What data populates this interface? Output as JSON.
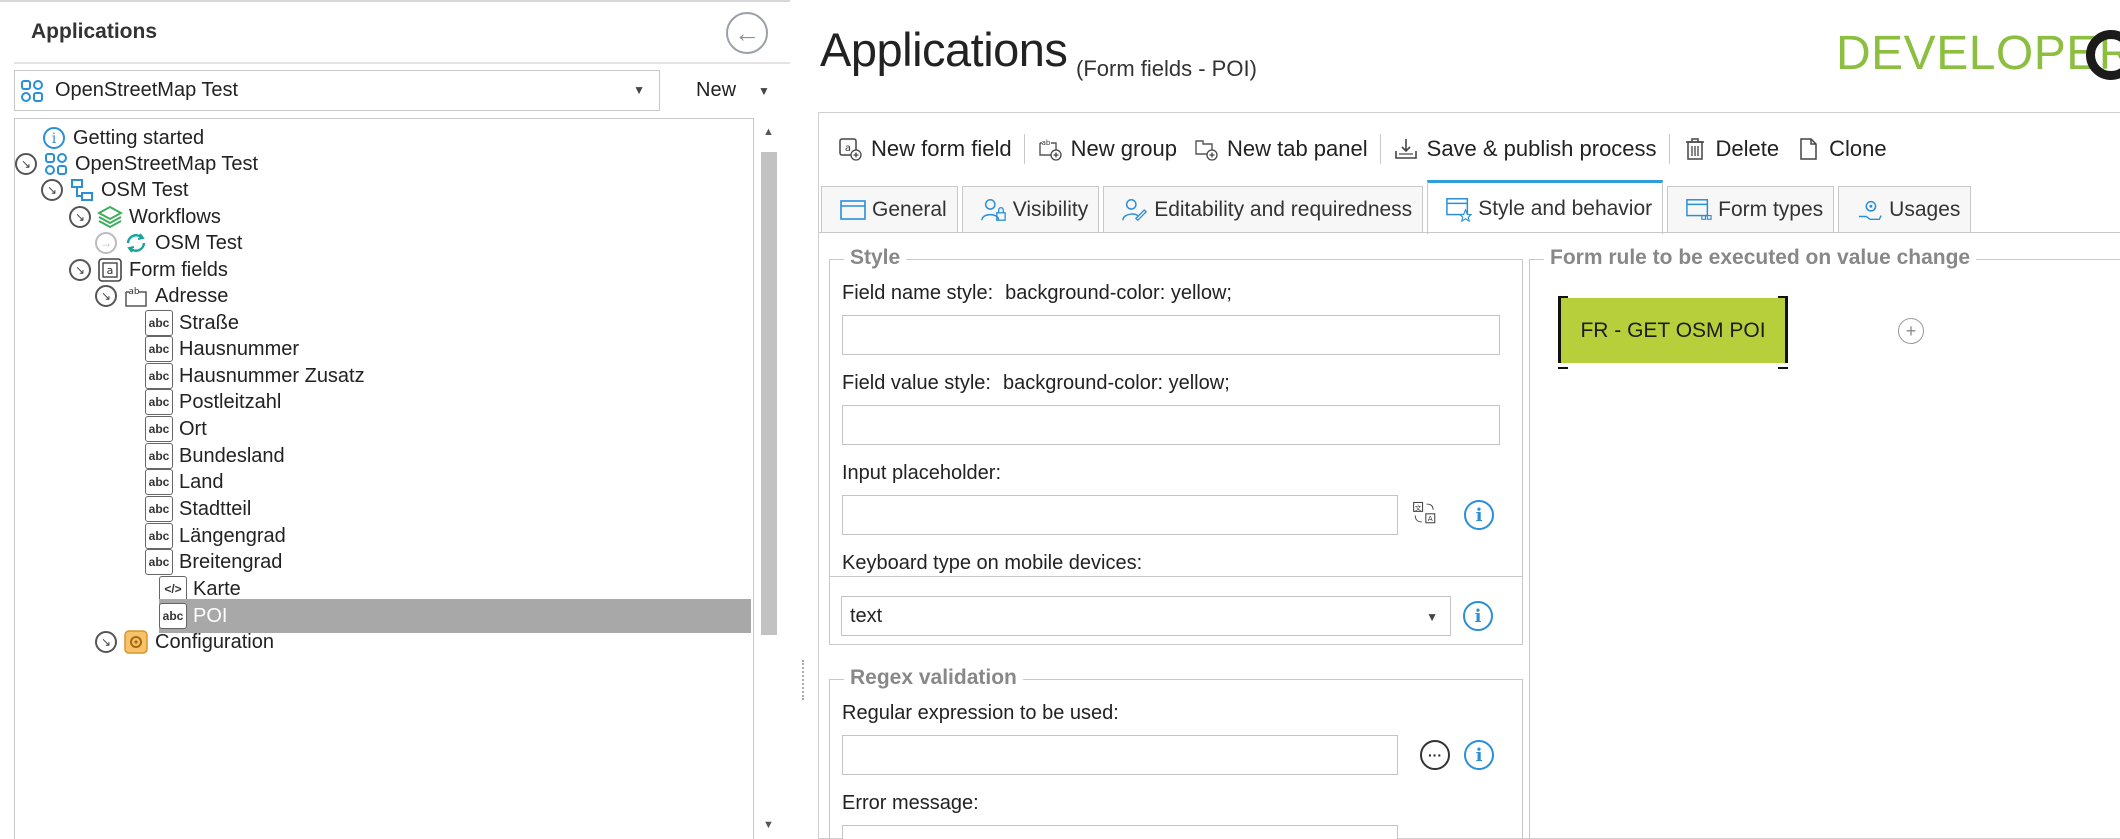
{
  "left_panel": {
    "title": "Applications",
    "app_select": {
      "value": "OpenStreetMap Test"
    },
    "new_label": "New",
    "tree": [
      {
        "label": "Getting started"
      },
      {
        "label": "OpenStreetMap Test"
      },
      {
        "label": "OSM Test"
      },
      {
        "label": "Workflows"
      },
      {
        "label": "OSM Test"
      },
      {
        "label": "Form fields"
      },
      {
        "label": "Adresse"
      },
      {
        "label": "Straße"
      },
      {
        "label": "Hausnummer"
      },
      {
        "label": "Hausnummer Zusatz"
      },
      {
        "label": "Postleitzahl"
      },
      {
        "label": "Ort"
      },
      {
        "label": "Bundesland"
      },
      {
        "label": "Land"
      },
      {
        "label": "Stadtteil"
      },
      {
        "label": "Längengrad"
      },
      {
        "label": "Breitengrad"
      },
      {
        "label": "Karte"
      },
      {
        "label": "POI"
      },
      {
        "label": "Configuration"
      }
    ]
  },
  "header": {
    "title": "Applications",
    "subtitle": "(Form fields - POI)",
    "brand": "DEVELOPER"
  },
  "toolbar": {
    "new_form_field": "New form field",
    "new_group": "New group",
    "new_tab_panel": "New tab panel",
    "save_publish": "Save & publish process",
    "delete": "Delete",
    "clone": "Clone"
  },
  "tabs": [
    {
      "label": "General"
    },
    {
      "label": "Visibility"
    },
    {
      "label": "Editability and requiredness"
    },
    {
      "label": "Style and behavior"
    },
    {
      "label": "Form types"
    },
    {
      "label": "Usages"
    }
  ],
  "style_group": {
    "title": "Style",
    "field_name_style_label": "Field name style:",
    "field_name_style_value": "background-color: yellow;",
    "field_value_style_label": "Field value style:",
    "field_value_style_value": "background-color: yellow;",
    "input_placeholder_label": "Input placeholder:",
    "keyboard_label": "Keyboard type on mobile devices:",
    "keyboard_value": "text"
  },
  "regex_group": {
    "title": "Regex validation",
    "regex_label": "Regular expression to be used:",
    "error_label": "Error message:"
  },
  "rule_group": {
    "title": "Form rule to be executed on value change",
    "rule_name": "FR - GET OSM POI"
  },
  "colors": {
    "brand_green": "#8cbf3f",
    "rule_chip": "#b7cf3a",
    "accent_blue": "#2e9fd8",
    "selected_row": "#a8a8a8"
  }
}
